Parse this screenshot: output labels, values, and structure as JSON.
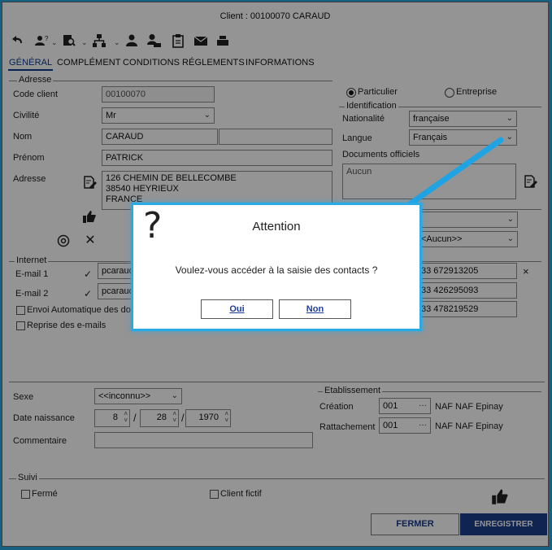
{
  "window": {
    "title": "Client : 00100070 CARAUD"
  },
  "toolbar": {
    "icons": [
      "undo-icon",
      "user-help-icon",
      "search-doc-icon",
      "hierarchy-icon",
      "person-icon",
      "person-card-icon",
      "clipboard-icon",
      "mail-icon",
      "printer-icon"
    ]
  },
  "tabs": [
    {
      "label": "GÉNÉRAL",
      "active": true
    },
    {
      "label": "COMPLÉMENT"
    },
    {
      "label": "CONDITIONS"
    },
    {
      "label": "RÉGLEMENTS"
    },
    {
      "label": "INFORMATIONS"
    }
  ],
  "adresse": {
    "section_title": "Adresse",
    "code_client_label": "Code client",
    "code_client": "00100070",
    "civilite_label": "Civilité",
    "civilite": "Mr",
    "nom_label": "Nom",
    "nom": "CARAUD",
    "prenom_label": "Prénom",
    "prenom": "PATRICK",
    "adresse_label": "Adresse",
    "adresse_lines": [
      "126 CHEMIN DE BELLECOMBE",
      "38540    HEYRIEUX",
      "FRANCE"
    ]
  },
  "type_client": {
    "particulier": "Particulier",
    "entreprise": "Entreprise",
    "selected": "Particulier"
  },
  "identification": {
    "section_title": "Identification",
    "nationalite_label": "Nationalité",
    "nationalite": "française",
    "langue_label": "Langue",
    "langue": "Français",
    "documents_label": "Documents officiels",
    "documents": "Aucun",
    "aucun_select": "<Aucun>>"
  },
  "internet": {
    "section_title": "Internet",
    "email1_label": "E-mail 1",
    "email1": "pcaraud",
    "email2_label": "E-mail 2",
    "email2": "pcaraud",
    "envoi_auto": "Envoi Automatique des doc",
    "reprise": "Reprise des e-mails"
  },
  "telephones": [
    "33 672913205",
    "33 426295093",
    "33 478219529"
  ],
  "divers": {
    "sexe_label": "Sexe",
    "sexe": "<<inconnu>>",
    "date_label": "Date naissance",
    "month": "8",
    "day": "28",
    "year": "1970",
    "commentaire_label": "Commentaire"
  },
  "etablissement": {
    "section_title": "Etablissement",
    "creation_label": "Création",
    "creation_code": "001",
    "creation_name": "NAF NAF Epinay",
    "rattachement_label": "Rattachement",
    "rattachement_code": "001",
    "rattachement_name": "NAF NAF Epinay",
    "ellipsis": "···"
  },
  "suivi": {
    "section_title": "Suivi",
    "ferme": "Fermé",
    "client_fictif": "Client fictif"
  },
  "buttons": {
    "fermer": "FERMER",
    "enregistrer": "ENREGISTRER"
  },
  "dialog": {
    "icon": "?",
    "title": "Attention",
    "message": "Voulez-vous accéder à la saisie des contacts ?",
    "oui": "Oui",
    "non": "Non"
  },
  "colors": {
    "accent": "#29a9e6",
    "primary_button": "#1d3e8c",
    "link_blue": "#1d3e9e"
  }
}
